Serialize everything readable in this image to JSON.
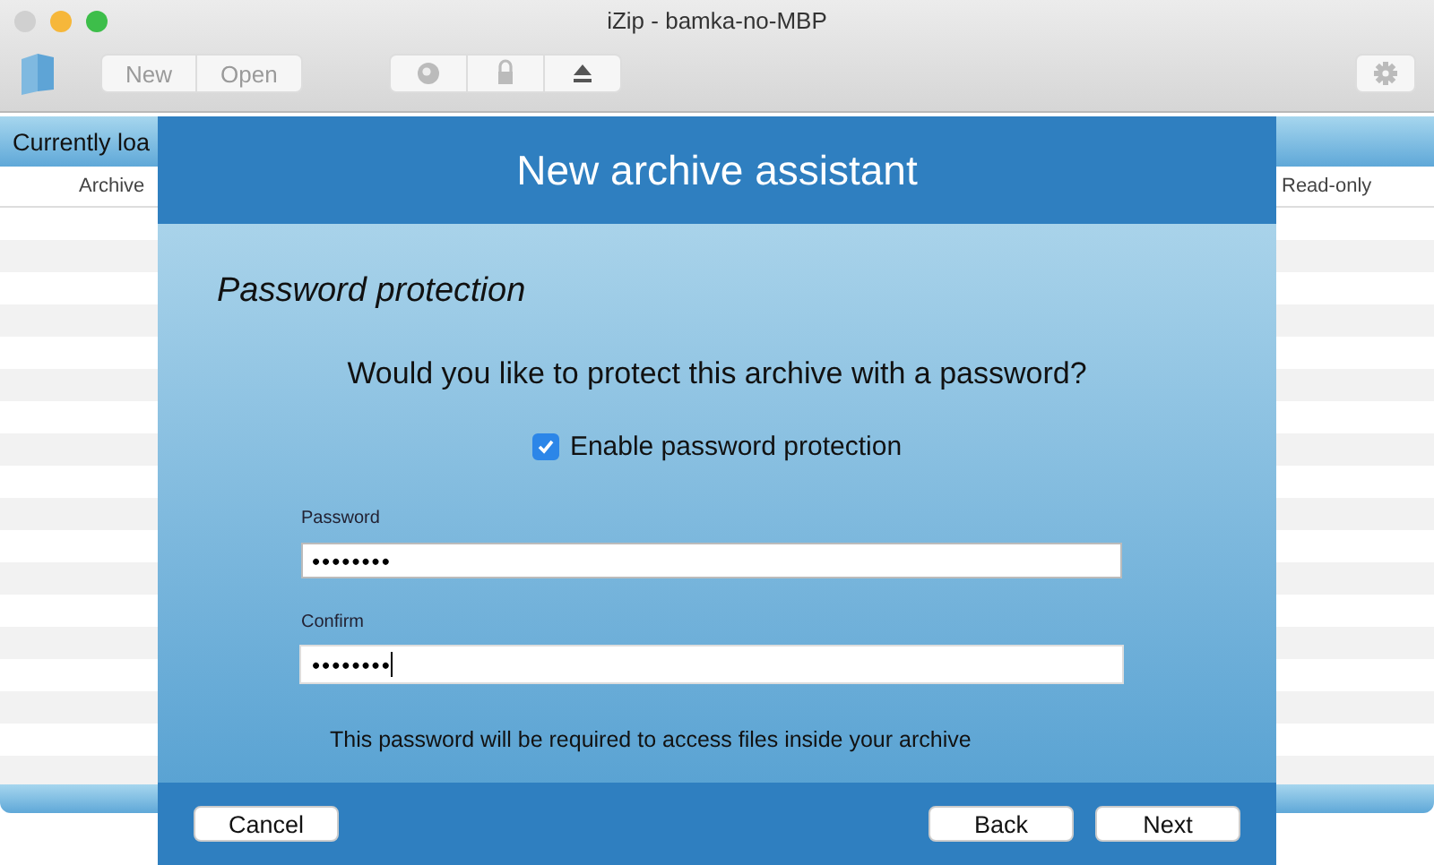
{
  "window": {
    "title": "iZip - bamka-no-MBP"
  },
  "toolbar": {
    "buttons": [
      {
        "label": "New"
      },
      {
        "label": "Open"
      }
    ]
  },
  "background": {
    "header": "Currently loa",
    "columns": [
      {
        "label": "Archive"
      },
      {
        "label": "Read-only"
      }
    ]
  },
  "sheet": {
    "title": "New archive assistant",
    "section": "Password protection",
    "question": "Would you like to protect this archive with a password?",
    "checkbox": {
      "label": "Enable password protection",
      "checked": true
    },
    "fields": [
      {
        "label": "Password",
        "value": "••••••••",
        "focused": false
      },
      {
        "label": "Confirm",
        "value": "••••••••",
        "focused": true
      }
    ],
    "note": "This password will be required to access files inside your archive",
    "buttons": [
      {
        "label": "Cancel",
        "kind": "left"
      },
      {
        "label": "Back",
        "kind": "right"
      },
      {
        "label": "Next",
        "kind": "right"
      }
    ]
  }
}
